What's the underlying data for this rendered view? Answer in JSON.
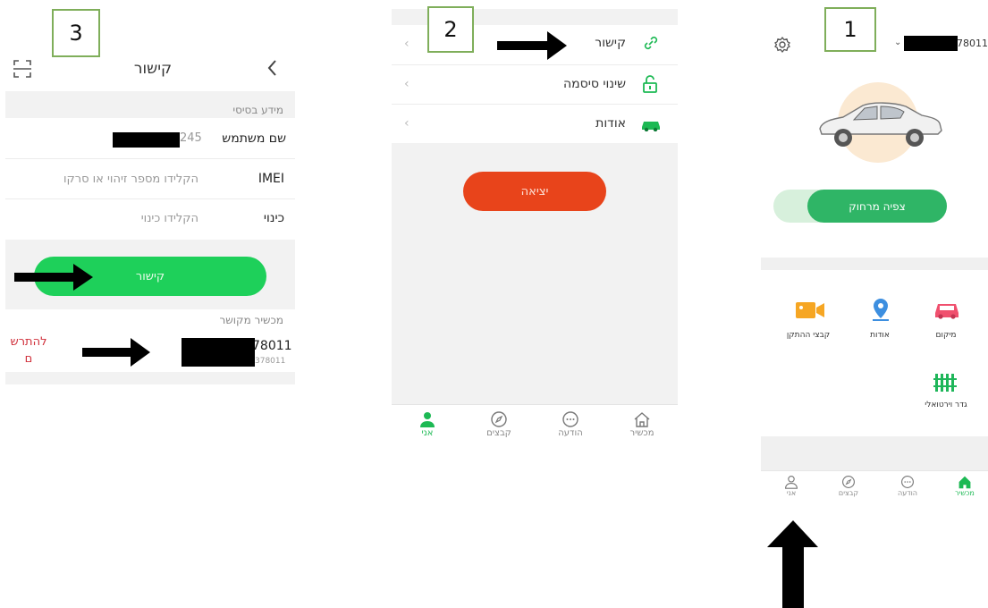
{
  "steps": {
    "s1": "1",
    "s2": "2",
    "s3": "3"
  },
  "screen1": {
    "device_id_suffix": "78011",
    "remote_view_label": "צפיה מרחוק",
    "tiles": [
      {
        "label": "מיקום",
        "icon": "car-icon"
      },
      {
        "label": "אודות",
        "icon": "location-pin-icon"
      },
      {
        "label": "קבצי ההתקן",
        "icon": "video-camera-icon"
      },
      {
        "label": "גדר וירטואלי",
        "icon": "fence-icon"
      }
    ],
    "nav": [
      {
        "label": "מכשיר",
        "icon": "home-icon",
        "active": true
      },
      {
        "label": "הודעה",
        "icon": "message-icon",
        "active": false
      },
      {
        "label": "קבצים",
        "icon": "compass-icon",
        "active": false
      },
      {
        "label": "אני",
        "icon": "person-icon",
        "active": false
      }
    ]
  },
  "screen2": {
    "menu": [
      {
        "label": "קישור",
        "icon": "link-icon"
      },
      {
        "label": "שינוי סיסמה",
        "icon": "unlock-icon"
      },
      {
        "label": "אודות",
        "icon": "car-icon"
      }
    ],
    "logout_label": "יציאה",
    "nav": [
      {
        "label": "מכשיר",
        "icon": "home-icon",
        "active": false
      },
      {
        "label": "הודעה",
        "icon": "message-icon",
        "active": false
      },
      {
        "label": "קבצים",
        "icon": "compass-icon",
        "active": false
      },
      {
        "label": "אני",
        "icon": "person-icon",
        "active": true
      }
    ]
  },
  "screen3": {
    "title": "קישור",
    "basic_info_header": "מידע בסיסי",
    "username_label": "שם משתמש",
    "username_suffix": "245",
    "imei_label": "IMEI",
    "imei_placeholder": "הקלידו מספר זיהוי או סרקו",
    "nickname_label": "כינוי",
    "nickname_placeholder": "הקלידו כינוי",
    "link_button_label": "קישור",
    "linked_device_header": "מכשיר מקושר",
    "device_suffix_main": "78011",
    "device_suffix_sub": "378011",
    "unregister_label": "להתרש\nם"
  },
  "colors": {
    "accent": "#1db954",
    "logout": "#e8441b",
    "unregister": "#d0303b",
    "step_border": "#7fae5a"
  }
}
